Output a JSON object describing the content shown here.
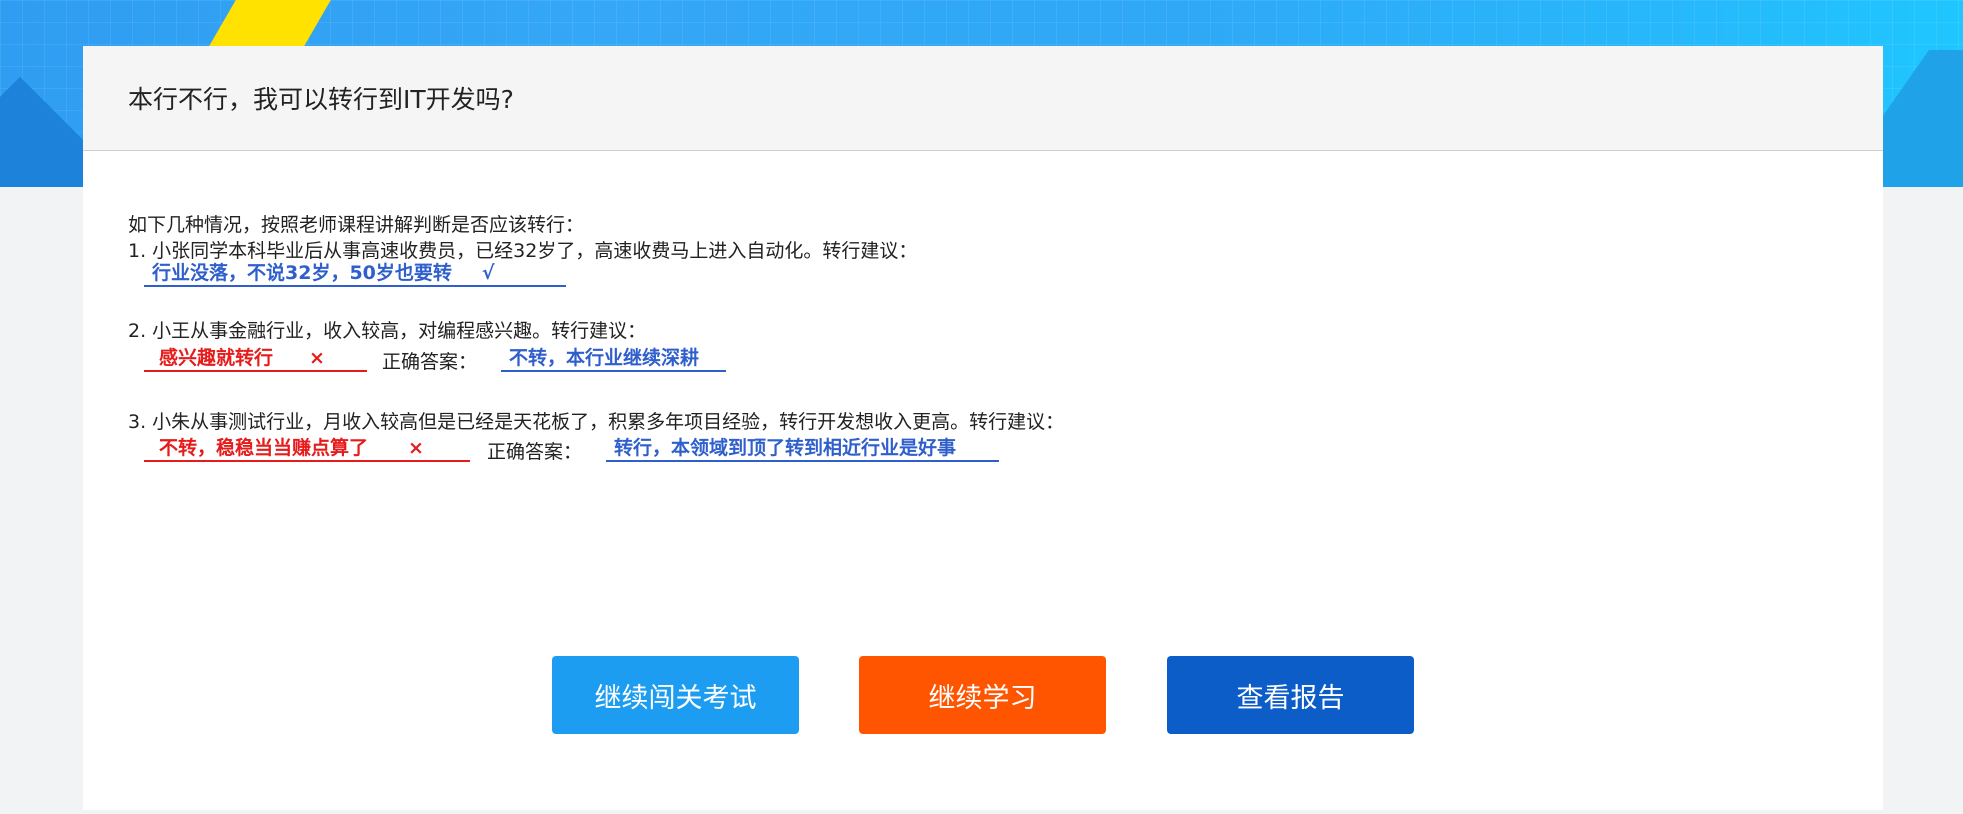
{
  "page": {
    "title": "本行不行，我可以转行到IT开发吗?"
  },
  "question": {
    "intro": "如下几种情况，按照老师课程讲解判断是否应该转行：",
    "items": [
      {
        "text": "1. 小张同学本科毕业后从事高速收费员，已经32岁了，高速收费马上进入自动化。转行建议：",
        "answer": "行业没落，不说32岁，50岁也要转",
        "mark": "√",
        "answer_color": "#2f5fcc"
      },
      {
        "text": "2. 小王从事金融行业，收入较高，对编程感兴趣。转行建议：",
        "answer": "感兴趣就转行",
        "mark": "×",
        "answer_color": "#e61b1b",
        "correct_label": "正确答案：",
        "correct_answer": "不转，本行业继续深耕"
      },
      {
        "text": "3. 小朱从事测试行业，月收入较高但是已经是天花板了，积累多年项目经验，转行开发想收入更高。转行建议：",
        "answer": "不转，稳稳当当赚点算了",
        "mark": "×",
        "answer_color": "#e61b1b",
        "correct_label": "正确答案：",
        "correct_answer": "转行，本领域到顶了转到相近行业是好事"
      }
    ]
  },
  "buttons": {
    "continue_exam": "继续闯关考试",
    "continue_study": "继续学习",
    "view_report": "查看报告"
  },
  "colors": {
    "continue_exam": "#1d9df1",
    "continue_study": "#ff5500",
    "view_report": "#0c5dc8",
    "correct": "#2f5fcc",
    "wrong": "#e61b1b"
  }
}
